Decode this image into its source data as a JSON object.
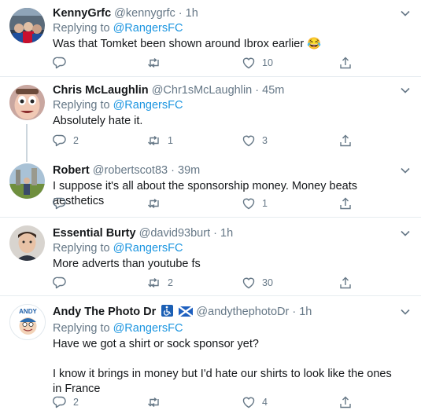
{
  "tweets": [
    {
      "name": "KennyGrfc",
      "handle": "@kennygrfc",
      "time": "1h",
      "replying_label": "Replying to",
      "replying_to": "@RangersFC",
      "text": [
        "Was that Tomket been shown around Ibrox earlier 😂"
      ],
      "replies": "",
      "retweets": "",
      "likes": "10"
    },
    {
      "name": "Chris McLaughlin",
      "handle": "@Chr1sMcLaughlin",
      "time": "45m",
      "replying_label": "Replying to",
      "replying_to": "@RangersFC",
      "text": [
        "Absolutely hate it."
      ],
      "replies": "2",
      "retweets": "1",
      "likes": "3"
    },
    {
      "name": "Robert",
      "handle": "@robertscot83",
      "time": "39m",
      "replying_label": "",
      "replying_to": "",
      "text": [
        "I suppose it's all about the sponsorship money. Money beats aesthetics"
      ],
      "replies": "",
      "retweets": "",
      "likes": "1"
    },
    {
      "name": "Essential Burty",
      "handle": "@david93burt",
      "time": "1h",
      "replying_label": "Replying to",
      "replying_to": "@RangersFC",
      "text": [
        "More adverts than youtube fs"
      ],
      "replies": "",
      "retweets": "2",
      "likes": "30"
    },
    {
      "name": "Andy The Photo Dr",
      "handle": "@andythephotoDr",
      "time": "1h",
      "replying_label": "Replying to",
      "replying_to": "@RangersFC",
      "text": [
        "Have we got a shirt or sock sponsor yet?",
        "I know it brings in money but I'd hate our shirts to look like the ones in France"
      ],
      "replies": "2",
      "retweets": "",
      "likes": "4",
      "avatar_text": "ANDY"
    }
  ],
  "separator": "·",
  "colors": {
    "link": "#1b95e0",
    "secondary": "#657786",
    "border": "#e6ecf0"
  }
}
